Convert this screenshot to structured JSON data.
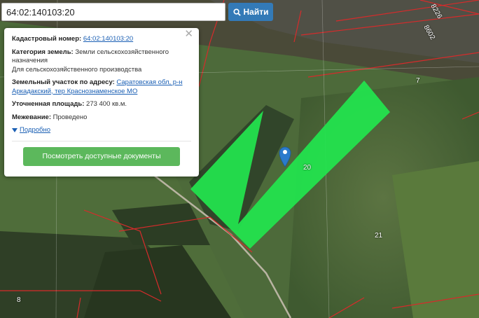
{
  "search": {
    "value": "64:02:140103:20",
    "button_label": "Найти",
    "icon": "search-icon"
  },
  "popup": {
    "cadastral_label": "Кадастровый номер:",
    "cadastral_value": "64:02:140103:20",
    "category_label": "Категория земель:",
    "category_value": "Земли сельскохозяйственного назначения",
    "category_use": "Для сельскохозяйственного производства",
    "address_label": "Земельный участок по адресу:",
    "address_value": "Саратовская обл, р-н Аркадакский, тер Краснознаменское МО",
    "area_label": "Уточненная площадь:",
    "area_value": "273 400 кв.м.",
    "survey_label": "Межевание:",
    "survey_value": "Проведено",
    "more_label": "Подробно",
    "docs_button": "Посмотреть доступные документы",
    "close_icon": "close-icon"
  },
  "map": {
    "plot_labels": [
      "20",
      "7",
      "21",
      "8",
      "8226",
      "8602"
    ],
    "colors": {
      "selected_parcel": "#22e64e",
      "parcel_border": "#d62b2b",
      "pin": "#2b7bcc"
    }
  }
}
